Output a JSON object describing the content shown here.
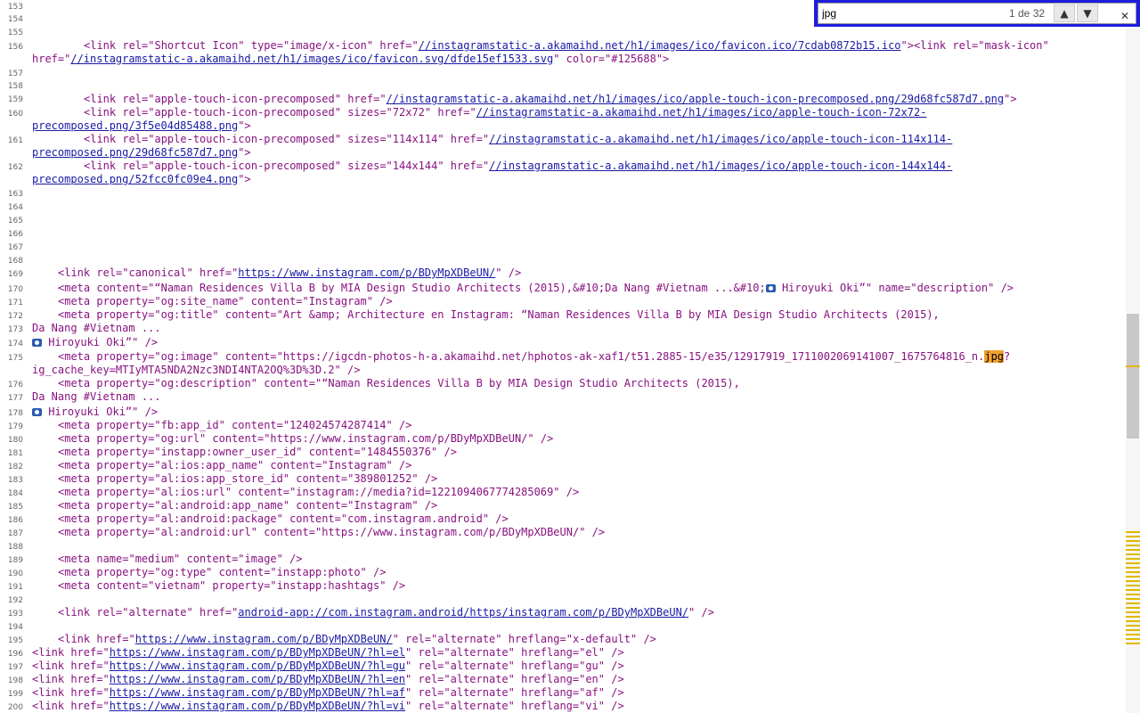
{
  "find": {
    "value": "jpg",
    "count": "1 de 32",
    "prev_icon": "chevron-up",
    "next_icon": "chevron-down",
    "close_icon": "close"
  },
  "colors": {
    "tag": "#881280",
    "attr_name": "#994500",
    "attr_value": "#1a1aa6",
    "highlight": "#f0a030",
    "find_bar": "#1d1ddc"
  },
  "line_numbers": [
    "153",
    "154",
    "155",
    "156",
    "157",
    "158",
    "159",
    "160",
    "161",
    "162",
    "163",
    "164",
    "165",
    "166",
    "167",
    "168",
    "169",
    "170",
    "171",
    "172",
    "173",
    "174",
    "175",
    "176",
    "177",
    "178",
    "179",
    "180",
    "181",
    "182",
    "183",
    "184",
    "185",
    "186",
    "187",
    "188",
    "189",
    "190",
    "191",
    "192",
    "193",
    "194",
    "195",
    "196",
    "197",
    "198",
    "199",
    "200"
  ],
  "code": {
    "l156a_1": "<link rel=\"Shortcut Icon\" type=\"image/x-icon\" href=\"",
    "l156a_link": "//instagramstatic-a.akamaihd.net/h1/images/ico/favicon.ico/7cdab0872b15.ico",
    "l156a_2": "\"><link rel=\"mask-icon\"",
    "l156b_1": "href=\"",
    "l156b_link": "//instagramstatic-a.akamaihd.net/h1/images/ico/favicon.svg/dfde15ef1533.svg",
    "l156b_2": "\" color=\"#125688\">",
    "l159_1": "<link rel=\"apple-touch-icon-precomposed\" href=\"",
    "l159_link": "//instagramstatic-a.akamaihd.net/h1/images/ico/apple-touch-icon-precomposed.png/29d68fc587d7.png",
    "l159_2": "\">",
    "l160a_1": "<link rel=\"apple-touch-icon-precomposed\" sizes=\"72x72\" href=\"",
    "l160a_link": "//instagramstatic-a.akamaihd.net/h1/images/ico/apple-touch-icon-72x72-",
    "l160b_link": "precomposed.png/3f5e04d85488.png",
    "l160b_2": "\">",
    "l161a_1": "<link rel=\"apple-touch-icon-precomposed\" sizes=\"114x114\" href=\"",
    "l161a_link": "//instagramstatic-a.akamaihd.net/h1/images/ico/apple-touch-icon-114x114-",
    "l161b_link": "precomposed.png/29d68fc587d7.png",
    "l161b_2": "\">",
    "l162a_1": "<link rel=\"apple-touch-icon-precomposed\" sizes=\"144x144\" href=\"",
    "l162a_link": "//instagramstatic-a.akamaihd.net/h1/images/ico/apple-touch-icon-144x144-",
    "l162b_link": "precomposed.png/52fcc0fc09e4.png",
    "l162b_2": "\">",
    "l169_1": "<link rel=\"canonical\" href=\"",
    "l169_link": "https://www.instagram.com/p/BDyMpXDBeUN/",
    "l169_2": "\" />",
    "l170_1": "<meta content=\"“Naman Residences Villa B by MIA Design Studio Architects (2015),&#10;Da Nang #Vietnam ...&#10;",
    "l170_2": " Hiroyuki Oki”\" name=\"description\" />",
    "l171": "<meta property=\"og:site_name\" content=\"Instagram\" />",
    "l172": "<meta property=\"og:title\" content=\"Art &amp; Architecture en Instagram: “Naman Residences Villa B by MIA Design Studio Architects (2015),",
    "l173": "Da Nang #Vietnam ...",
    "l174": " Hiroyuki Oki”\" />",
    "l175a_1": "<meta property=\"og:image\" content=\"https://igcdn-photos-h-a.akamaihd.net/hphotos-ak-xaf1/t51.2885-15/e35/12917919_1711002069141007_1675764816_n.",
    "l175a_hl": "jpg",
    "l175a_2": "?",
    "l175b": "ig_cache_key=MTIyMTA5NDA2Nzc3NDI4NTA2OQ%3D%3D.2\" />",
    "l176": "<meta property=\"og:description\" content=\"“Naman Residences Villa B by MIA Design Studio Architects (2015),",
    "l177": "Da Nang #Vietnam ...",
    "l178": " Hiroyuki Oki”\" />",
    "l179": "<meta property=\"fb:app_id\" content=\"124024574287414\" />",
    "l180": "<meta property=\"og:url\" content=\"https://www.instagram.com/p/BDyMpXDBeUN/\" />",
    "l181": "<meta property=\"instapp:owner_user_id\" content=\"1484550376\" />",
    "l182": "<meta property=\"al:ios:app_name\" content=\"Instagram\" />",
    "l183": "<meta property=\"al:ios:app_store_id\" content=\"389801252\" />",
    "l184": "<meta property=\"al:ios:url\" content=\"instagram://media?id=1221094067774285069\" />",
    "l185": "<meta property=\"al:android:app_name\" content=\"Instagram\" />",
    "l186": "<meta property=\"al:android:package\" content=\"com.instagram.android\" />",
    "l187": "<meta property=\"al:android:url\" content=\"https://www.instagram.com/p/BDyMpXDBeUN/\" />",
    "l189": "<meta name=\"medium\" content=\"image\" />",
    "l190": "<meta property=\"og:type\" content=\"instapp:photo\" />",
    "l191": "<meta content=\"vietnam\" property=\"instapp:hashtags\" />",
    "l193_1": "<link rel=\"alternate\" href=\"",
    "l193_link": "android-app://com.instagram.android/https/instagram.com/p/BDyMpXDBeUN/",
    "l193_2": "\" />",
    "l195_1": "<link href=\"",
    "l195_link": "https://www.instagram.com/p/BDyMpXDBeUN/",
    "l195_2": "\" rel=\"alternate\" hreflang=\"x-default\" />",
    "l196_1": "<link href=\"",
    "l196_link": "https://www.instagram.com/p/BDyMpXDBeUN/?hl=el",
    "l196_2": "\" rel=\"alternate\" hreflang=\"el\" />",
    "l197_1": "<link href=\"",
    "l197_link": "https://www.instagram.com/p/BDyMpXDBeUN/?hl=gu",
    "l197_2": "\" rel=\"alternate\" hreflang=\"gu\" />",
    "l198_1": "<link href=\"",
    "l198_link": "https://www.instagram.com/p/BDyMpXDBeUN/?hl=en",
    "l198_2": "\" rel=\"alternate\" hreflang=\"en\" />",
    "l199_1": "<link href=\"",
    "l199_link": "https://www.instagram.com/p/BDyMpXDBeUN/?hl=af",
    "l199_2": "\" rel=\"alternate\" hreflang=\"af\" />",
    "l200_1": "<link href=\"",
    "l200_link": "https://www.instagram.com/p/BDyMpXDBeUN/?hl=vi",
    "l200_2": "\" rel=\"alternate\" hreflang=\"vi\" />"
  }
}
